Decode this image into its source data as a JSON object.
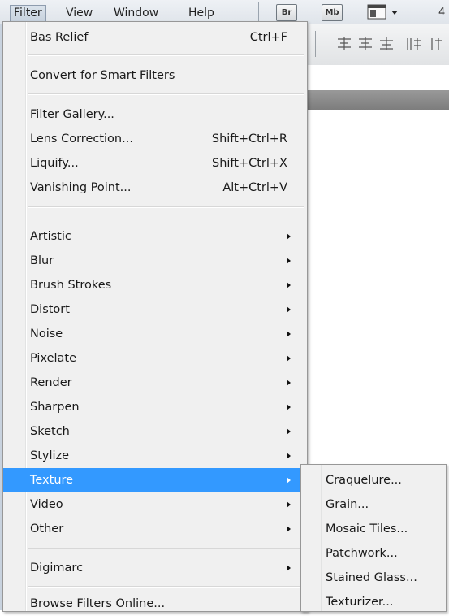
{
  "menubar": {
    "items": [
      {
        "label": "Filter"
      },
      {
        "label": "View"
      },
      {
        "label": "Window"
      },
      {
        "label": "Help"
      }
    ],
    "app_buttons": [
      "Br",
      "Mb"
    ],
    "truncated_text": "4"
  },
  "filter_menu": {
    "top_group": [
      {
        "label": "Bas Relief",
        "shortcut": "Ctrl+F"
      }
    ],
    "smart_group": [
      {
        "label": "Convert for Smart Filters"
      }
    ],
    "tools_group": [
      {
        "label": "Filter Gallery...",
        "shortcut": ""
      },
      {
        "label": "Lens Correction...",
        "shortcut": "Shift+Ctrl+R"
      },
      {
        "label": "Liquify...",
        "shortcut": "Shift+Ctrl+X"
      },
      {
        "label": "Vanishing Point...",
        "shortcut": "Alt+Ctrl+V"
      }
    ],
    "categories": [
      {
        "label": "Artistic"
      },
      {
        "label": "Blur"
      },
      {
        "label": "Brush Strokes"
      },
      {
        "label": "Distort"
      },
      {
        "label": "Noise"
      },
      {
        "label": "Pixelate"
      },
      {
        "label": "Render"
      },
      {
        "label": "Sharpen"
      },
      {
        "label": "Sketch"
      },
      {
        "label": "Stylize"
      },
      {
        "label": "Texture"
      },
      {
        "label": "Video"
      },
      {
        "label": "Other"
      }
    ],
    "plugins": [
      {
        "label": "Digimarc"
      }
    ],
    "browse": {
      "label": "Browse Filters Online..."
    }
  },
  "texture_submenu": {
    "items": [
      {
        "label": "Craquelure..."
      },
      {
        "label": "Grain..."
      },
      {
        "label": "Mosaic Tiles..."
      },
      {
        "label": "Patchwork..."
      },
      {
        "label": "Stained Glass..."
      },
      {
        "label": "Texturizer..."
      }
    ]
  },
  "colors": {
    "highlight": "#3399ff",
    "menu_bg": "#f0f0f0"
  }
}
